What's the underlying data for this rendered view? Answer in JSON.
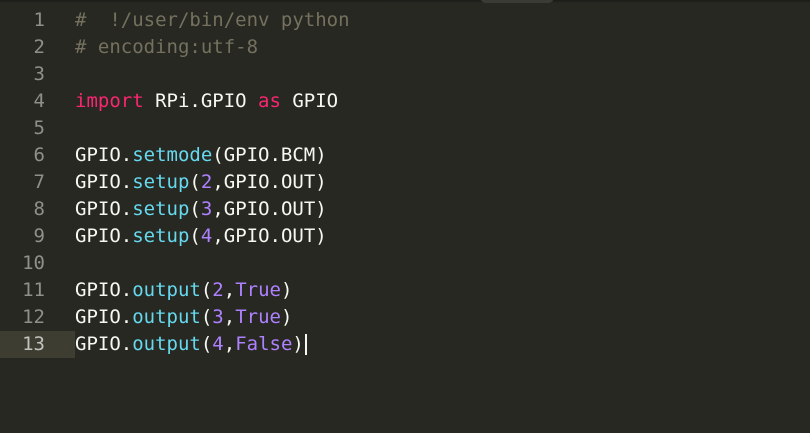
{
  "editor": {
    "language": "python",
    "cursor_line": 13,
    "lines": [
      {
        "n": "1",
        "tokens": [
          {
            "t": "#  !/user/bin/env python",
            "c": "cmt"
          }
        ]
      },
      {
        "n": "2",
        "tokens": [
          {
            "t": "# encoding:utf-8",
            "c": "cmt"
          }
        ]
      },
      {
        "n": "3",
        "tokens": []
      },
      {
        "n": "4",
        "tokens": [
          {
            "t": "import",
            "c": "kw"
          },
          {
            "t": " RPi.GPIO ",
            "c": "plain"
          },
          {
            "t": "as",
            "c": "kw"
          },
          {
            "t": " GPIO",
            "c": "plain"
          }
        ]
      },
      {
        "n": "5",
        "tokens": []
      },
      {
        "n": "6",
        "tokens": [
          {
            "t": "GPIO.",
            "c": "plain"
          },
          {
            "t": "setmode",
            "c": "fn"
          },
          {
            "t": "(GPIO.BCM)",
            "c": "plain"
          }
        ]
      },
      {
        "n": "7",
        "tokens": [
          {
            "t": "GPIO.",
            "c": "plain"
          },
          {
            "t": "setup",
            "c": "fn"
          },
          {
            "t": "(",
            "c": "plain"
          },
          {
            "t": "2",
            "c": "num"
          },
          {
            "t": ",GPIO.OUT)",
            "c": "plain"
          }
        ]
      },
      {
        "n": "8",
        "tokens": [
          {
            "t": "GPIO.",
            "c": "plain"
          },
          {
            "t": "setup",
            "c": "fn"
          },
          {
            "t": "(",
            "c": "plain"
          },
          {
            "t": "3",
            "c": "num"
          },
          {
            "t": ",GPIO.OUT)",
            "c": "plain"
          }
        ]
      },
      {
        "n": "9",
        "tokens": [
          {
            "t": "GPIO.",
            "c": "plain"
          },
          {
            "t": "setup",
            "c": "fn"
          },
          {
            "t": "(",
            "c": "plain"
          },
          {
            "t": "4",
            "c": "num"
          },
          {
            "t": ",GPIO.OUT)",
            "c": "plain"
          }
        ]
      },
      {
        "n": "10",
        "tokens": []
      },
      {
        "n": "11",
        "tokens": [
          {
            "t": "GPIO.",
            "c": "plain"
          },
          {
            "t": "output",
            "c": "fn"
          },
          {
            "t": "(",
            "c": "plain"
          },
          {
            "t": "2",
            "c": "num"
          },
          {
            "t": ",",
            "c": "plain"
          },
          {
            "t": "True",
            "c": "const"
          },
          {
            "t": ")",
            "c": "plain"
          }
        ]
      },
      {
        "n": "12",
        "tokens": [
          {
            "t": "GPIO.",
            "c": "plain"
          },
          {
            "t": "output",
            "c": "fn"
          },
          {
            "t": "(",
            "c": "plain"
          },
          {
            "t": "3",
            "c": "num"
          },
          {
            "t": ",",
            "c": "plain"
          },
          {
            "t": "True",
            "c": "const"
          },
          {
            "t": ")",
            "c": "plain"
          }
        ]
      },
      {
        "n": "13",
        "tokens": [
          {
            "t": "GPIO.",
            "c": "plain"
          },
          {
            "t": "output",
            "c": "fn"
          },
          {
            "t": "(",
            "c": "plain"
          },
          {
            "t": "4",
            "c": "num"
          },
          {
            "t": ",",
            "c": "plain"
          },
          {
            "t": "False",
            "c": "const"
          },
          {
            "t": ")",
            "c": "plain"
          }
        ]
      }
    ]
  },
  "colors": {
    "background": "#272822",
    "gutter_text": "#8f908a",
    "comment": "#75715e",
    "keyword": "#f92672",
    "function": "#66d9ef",
    "number": "#ae81ff",
    "text": "#f8f8f2"
  }
}
